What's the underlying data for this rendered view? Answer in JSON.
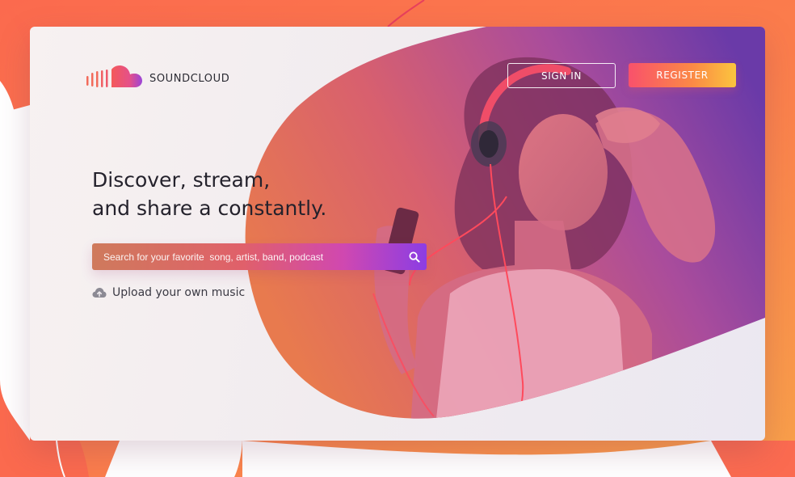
{
  "brand": {
    "name": "SOUNDCLOUD",
    "logo_icon": "soundcloud-cloud-icon"
  },
  "nav": {
    "signin_label": "SIGN IN",
    "register_label": "REGISTER"
  },
  "hero": {
    "headline_line1": "Discover, stream,",
    "headline_line2": "and share a constantly."
  },
  "search": {
    "placeholder": "Search for your favorite  song, artist, band, podcast",
    "icon": "search-icon"
  },
  "upload": {
    "label": "Upload your own music",
    "icon": "cloud-upload-icon"
  },
  "colors": {
    "accent_orange": "#fb8a45",
    "accent_pink": "#f9516b",
    "accent_purple": "#8b3de4",
    "headline_text": "#24222c"
  }
}
